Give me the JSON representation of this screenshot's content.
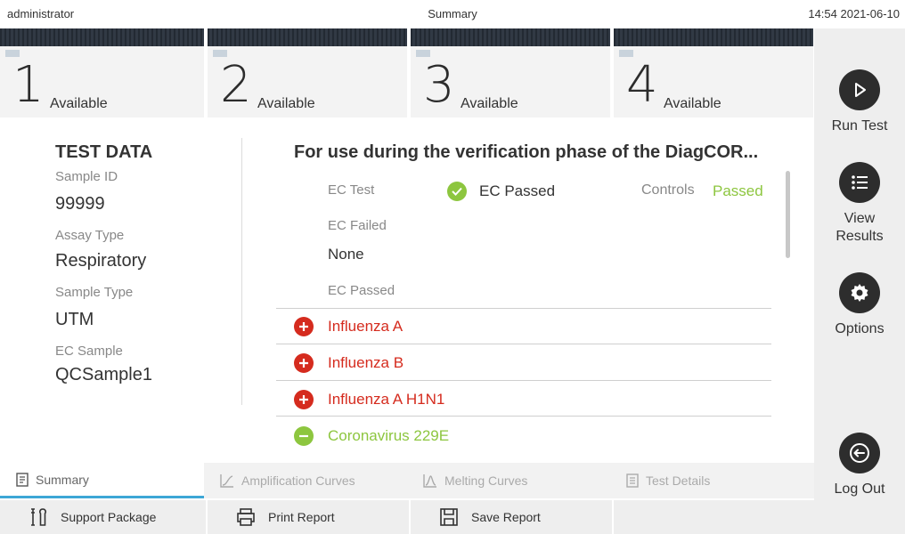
{
  "topbar": {
    "user": "administrator",
    "title": "Summary",
    "datetime": "14:54 2021-06-10"
  },
  "modules": [
    {
      "number": "1",
      "tiny_label": "--:--",
      "status": "Available"
    },
    {
      "number": "2",
      "tiny_label": "--:--",
      "status": "Available"
    },
    {
      "number": "3",
      "tiny_label": "--:--",
      "status": "Available"
    },
    {
      "number": "4",
      "tiny_label": "--:--",
      "status": "Available"
    }
  ],
  "sidebar": {
    "run_test": {
      "label": "Run Test",
      "icon": "play-icon"
    },
    "view_results": {
      "label": "View Results",
      "icon": "list-icon"
    },
    "options": {
      "label": "Options",
      "icon": "gear-icon"
    },
    "log_out": {
      "label": "Log Out",
      "icon": "logout-icon"
    }
  },
  "test_data": {
    "heading": "TEST DATA",
    "sample_id_label": "Sample ID",
    "sample_id": "99999",
    "assay_type_label": "Assay Type",
    "assay_type": "Respiratory",
    "sample_type_label": "Sample Type",
    "sample_type": "UTM",
    "ec_sample_label": "EC Sample",
    "ec_sample": "QCSample1"
  },
  "results": {
    "title": "For use during the verification phase of the DiagCOR...",
    "ec_test_label": "EC Test",
    "ec_status": "EC Passed",
    "controls_label": "Controls",
    "controls_status": "Passed",
    "ec_failed_label": "EC Failed",
    "ec_failed_value": "None",
    "ec_passed_label": "EC Passed",
    "pathogens": [
      {
        "name": "Influenza A",
        "result": "positive"
      },
      {
        "name": "Influenza B",
        "result": "positive"
      },
      {
        "name": "Influenza A H1N1",
        "result": "positive"
      },
      {
        "name": "Coronavirus 229E",
        "result": "negative"
      }
    ]
  },
  "view_tabs": [
    {
      "label": "Summary",
      "icon": "document-icon",
      "active": true
    },
    {
      "label": "Amplification Curves",
      "icon": "curve-icon",
      "active": false
    },
    {
      "label": "Melting Curves",
      "icon": "melting-icon",
      "active": false
    },
    {
      "label": "Test Details",
      "icon": "details-icon",
      "active": false
    }
  ],
  "actions": {
    "support_package": "Support Package",
    "print_report": "Print Report",
    "save_report": "Save Report"
  },
  "colors": {
    "positive": "#d52b1e",
    "negative": "#8dc63f",
    "passed": "#8dc63f",
    "active_tab": "#3da7d6",
    "dark_button": "#2d2d2d"
  }
}
